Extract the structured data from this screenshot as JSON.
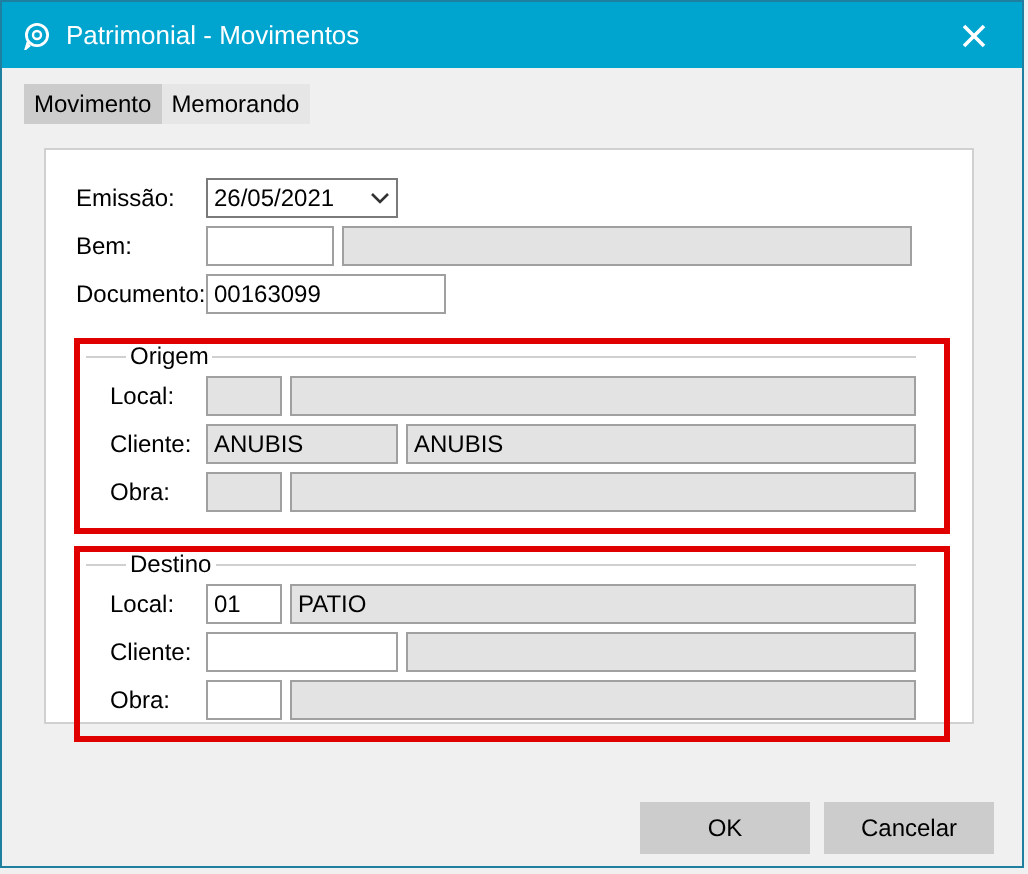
{
  "window": {
    "title": "Patrimonial - Movimentos"
  },
  "tabs": [
    {
      "label": "Movimento",
      "selected": true
    },
    {
      "label": "Memorando",
      "selected": false
    }
  ],
  "header_rows": [
    {
      "label": "Emissão:",
      "fields": [
        {
          "kind": "date",
          "value": "26/05/2021",
          "disabled": false
        }
      ]
    },
    {
      "label": "Bem:",
      "fields": [
        {
          "kind": "code",
          "disabled": false
        },
        {
          "kind": "name",
          "disabled": true
        }
      ]
    },
    {
      "label": "Documento:",
      "fields": [
        {
          "kind": "document",
          "value": "00163099",
          "disabled": false
        }
      ]
    }
  ],
  "sections": [
    {
      "legend": "Origem",
      "highlighted": true,
      "rows": [
        {
          "label": "Local:",
          "fields": [
            {
              "kind": "code-small",
              "disabled": true
            },
            {
              "kind": "name",
              "disabled": true
            }
          ]
        },
        {
          "label": "Cliente:",
          "fields": [
            {
              "kind": "code-medium",
              "value": "ANUBIS",
              "disabled": true
            },
            {
              "kind": "name",
              "value": "ANUBIS",
              "disabled": true
            }
          ]
        },
        {
          "label": "Obra:",
          "fields": [
            {
              "kind": "code-small",
              "disabled": true
            },
            {
              "kind": "name",
              "disabled": true
            }
          ]
        }
      ]
    },
    {
      "legend": "Destino",
      "highlighted": true,
      "rows": [
        {
          "label": "Local:",
          "fields": [
            {
              "kind": "code-small",
              "value": "01",
              "disabled": false
            },
            {
              "kind": "name",
              "value": "PATIO",
              "disabled": true
            }
          ]
        },
        {
          "label": "Cliente:",
          "fields": [
            {
              "kind": "code-medium",
              "disabled": false
            },
            {
              "kind": "name",
              "disabled": true
            }
          ]
        },
        {
          "label": "Obra:",
          "fields": [
            {
              "kind": "code-small",
              "disabled": false
            },
            {
              "kind": "name",
              "disabled": true
            }
          ]
        }
      ]
    }
  ],
  "buttons": [
    {
      "label": "OK"
    },
    {
      "label": "Cancelar"
    }
  ]
}
